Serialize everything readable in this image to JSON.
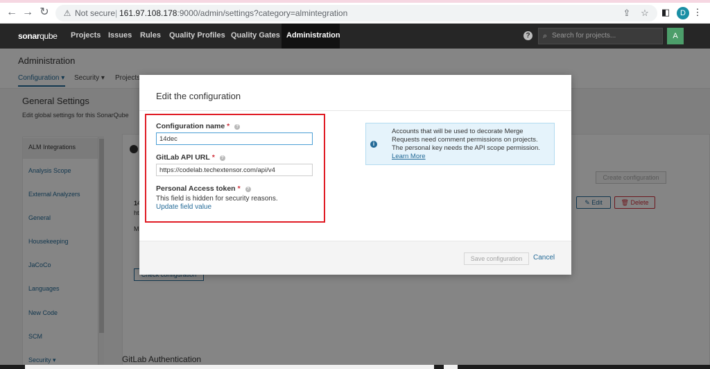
{
  "browser": {
    "security_label": "Not secure",
    "url_host": "161.97.108.178",
    "url_rest": ":9000/admin/settings?category=almintegration",
    "profile_initial": "D"
  },
  "sonar_nav": {
    "logo_bold": "sonar",
    "logo_rest": "qube",
    "items": [
      "Projects",
      "Issues",
      "Rules",
      "Quality Profiles",
      "Quality Gates",
      "Administration"
    ],
    "search_placeholder": "Search for projects...",
    "avatar_initial": "A"
  },
  "admin": {
    "title": "Administration",
    "tabs": [
      "Configuration ▾",
      "Security ▾",
      "Projects"
    ]
  },
  "general_settings": {
    "title": "General Settings",
    "description": "Edit global settings for this SonarQube"
  },
  "sidebar": {
    "items": [
      "ALM Integrations",
      "Analysis Scope",
      "External Analyzers",
      "General",
      "Housekeeping",
      "JaCoCo",
      "Languages",
      "New Code",
      "SCM",
      "Security ▾"
    ]
  },
  "main_card": {
    "create_button": "Create configuration",
    "edit_button": "Edit",
    "delete_button": "Delete",
    "check_button": "Check configuration",
    "row_fragment_1": "14",
    "row_fragment_2": "ht",
    "row_fragment_3": "M"
  },
  "gitlab_auth_heading": "GitLab Authentication",
  "modal": {
    "title": "Edit the configuration",
    "fields": {
      "config_name_label": "Configuration name",
      "config_name_value": "14dec",
      "api_url_label": "GitLab API URL",
      "api_url_value": "https://codelab.techextensor.com/api/v4",
      "token_label": "Personal Access token",
      "token_hint": "This field is hidden for security reasons.",
      "token_update_link": "Update field value"
    },
    "info": {
      "line1": "Accounts that will be used to decorate Merge",
      "line2": "Requests need comment permissions on projects.",
      "line3": "The personal key needs the API scope permission.",
      "link": "Learn More"
    },
    "save_button": "Save configuration",
    "cancel_link": "Cancel"
  },
  "colors": {
    "accent_link": "#236a97",
    "required": "#d02f3a",
    "highlight_box": "#e01b24",
    "info_bg": "#e5f3fb"
  }
}
